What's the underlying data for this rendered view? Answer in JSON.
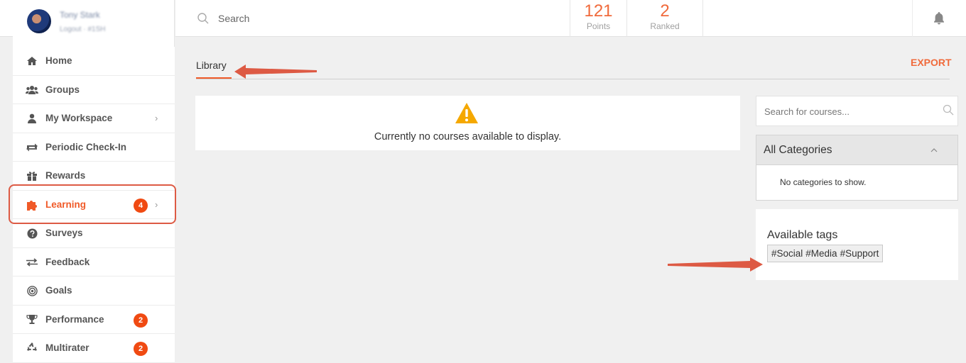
{
  "user": {
    "name": "Tony Stark",
    "sub": "Logout · #1SH"
  },
  "search": {
    "placeholder": "Search"
  },
  "stats": [
    {
      "value": "121",
      "label": "Points"
    },
    {
      "value": "2",
      "label": "Ranked"
    }
  ],
  "sidebar": {
    "items": [
      {
        "label": "Home",
        "icon": "home-icon"
      },
      {
        "label": "Groups",
        "icon": "groups-icon"
      },
      {
        "label": "My Workspace",
        "icon": "user-icon",
        "chevron": "›"
      },
      {
        "label": "Periodic Check-In",
        "icon": "exchange-icon"
      },
      {
        "label": "Rewards",
        "icon": "gift-icon"
      },
      {
        "label": "Learning",
        "icon": "puzzle-icon",
        "badge": "4",
        "chevron": "›",
        "active": true
      },
      {
        "label": "Surveys",
        "icon": "question-icon"
      },
      {
        "label": "Feedback",
        "icon": "arrows-icon"
      },
      {
        "label": "Goals",
        "icon": "target-icon"
      },
      {
        "label": "Performance",
        "icon": "trophy-icon",
        "badge": "2"
      },
      {
        "label": "Multirater",
        "icon": "recycle-icon",
        "badge": "2"
      }
    ]
  },
  "main": {
    "tab_label": "Library",
    "export_label": "EXPORT",
    "notice": "Currently no courses available to display."
  },
  "right": {
    "course_search_placeholder": "Search for courses...",
    "categories_title": "All Categories",
    "categories_empty": "No categories to show.",
    "tags_title": "Available tags",
    "tags": [
      "#Social",
      "#Media",
      "#Support"
    ]
  },
  "colors": {
    "accent": "#f05a28",
    "badge": "#f04a12",
    "warning": "#f5a800",
    "annotation": "#dd5a44"
  }
}
